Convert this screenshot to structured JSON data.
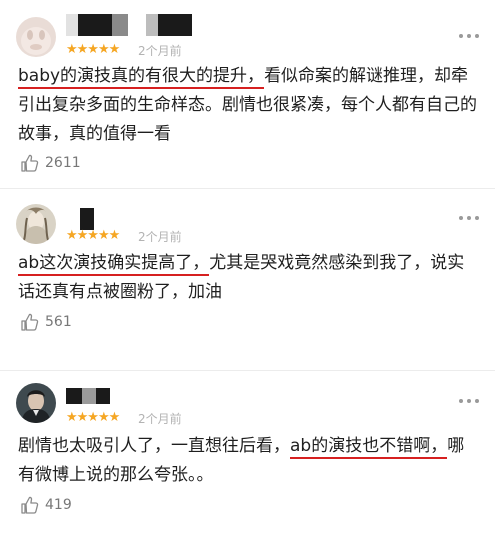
{
  "reviews": [
    {
      "rating": "★★★★★",
      "time": "2个月前",
      "text_parts": [
        "baby的演技真的有很大的提升，",
        "看似命案的解谜推理，却牵引出复杂多面的生命样态。剧情也很紧凑，每个人都有自己的故事，真的值得一看"
      ],
      "likes": "2611"
    },
    {
      "rating": "★★★★★",
      "time": "2个月前",
      "text_parts": [
        "ab这次演技确实提高了，",
        "尤其是哭戏竟然感染到我了，说实话还真有点被圈粉了，加油"
      ],
      "likes": "561"
    },
    {
      "rating": "★★★★★",
      "time": "2个月前",
      "text_parts": [
        "剧情也太吸引人了，一直想往后看，",
        "ab的演技也不错啊，",
        "哪有微博上说的那么夸张。。"
      ],
      "likes": "419"
    }
  ],
  "colors": {
    "star": "#f5a623",
    "highlight_underline": "#d62020",
    "meta_text": "#b3b3b3"
  },
  "icons": {
    "like": "thumbs-up-icon",
    "more": "more-dots-icon"
  }
}
